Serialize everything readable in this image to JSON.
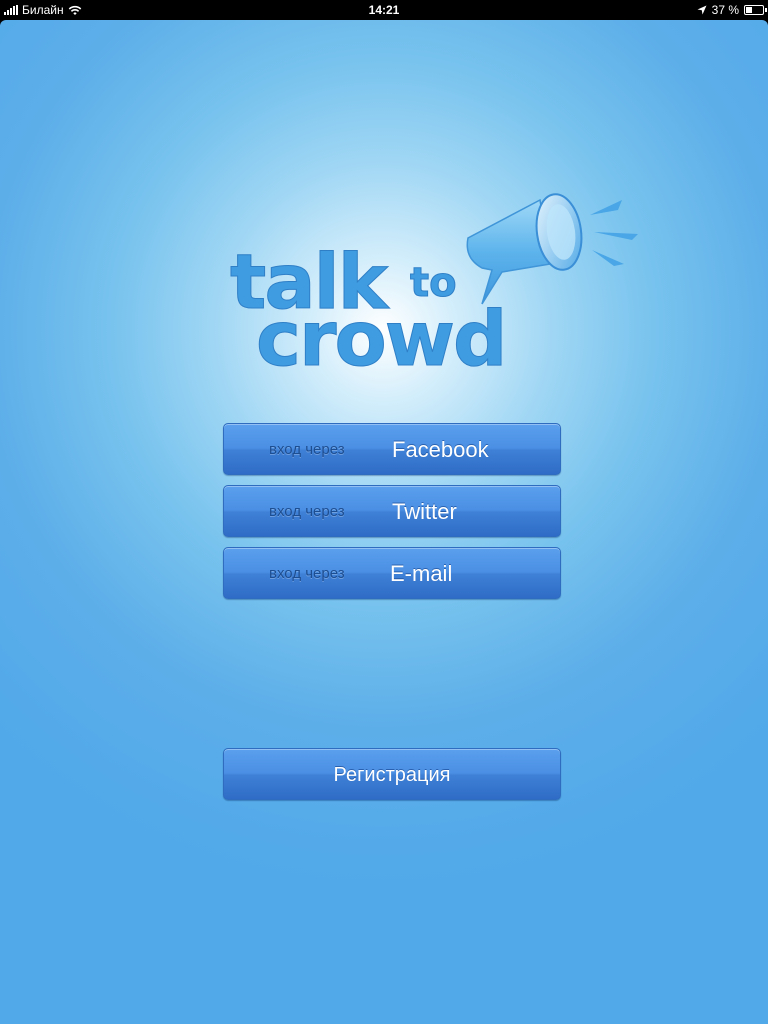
{
  "status_bar": {
    "carrier": "Билайн",
    "time": "14:21",
    "battery_percent_label": "37 %",
    "battery_level": 0.37,
    "icons": [
      "signal-icon",
      "wifi-icon",
      "location-arrow-icon",
      "battery-icon"
    ]
  },
  "logo": {
    "line1": "talk",
    "line1_small": "to",
    "line2": "crowd",
    "icon": "megaphone-icon"
  },
  "login_buttons": [
    {
      "prefix": "вход через",
      "provider": "Facebook"
    },
    {
      "prefix": "вход через",
      "provider": "Twitter"
    },
    {
      "prefix": "вход через",
      "provider": "E-mail"
    }
  ],
  "register_button": {
    "label": "Регистрация"
  },
  "colors": {
    "background": "#51a9e9",
    "glow": "#ffffff",
    "button_top": "#5aa0ee",
    "button_bottom": "#2f6cc7",
    "button_prefix_text": "#1e4e92",
    "logo_blue": "#3f9ce0"
  }
}
